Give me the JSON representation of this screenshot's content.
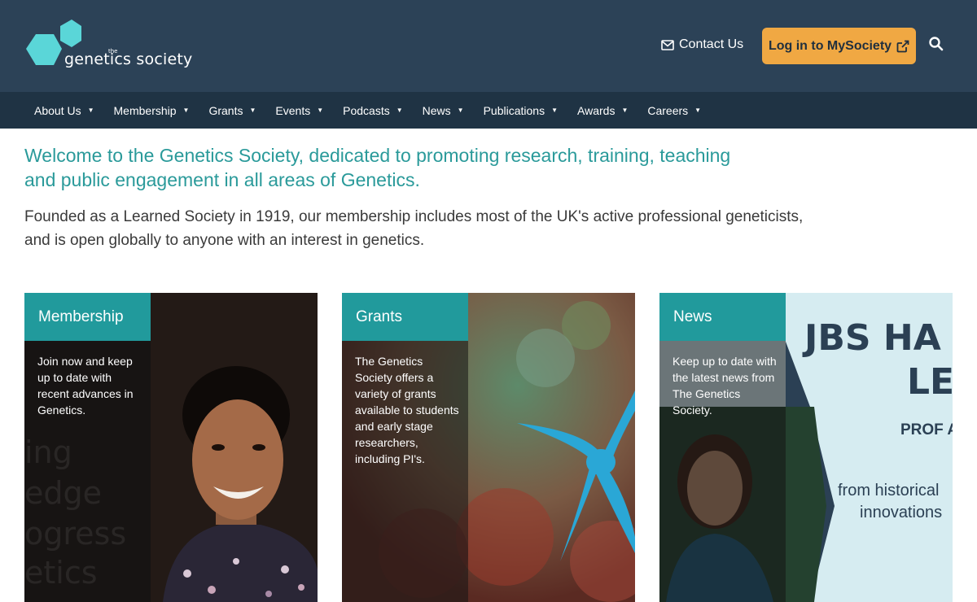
{
  "header": {
    "logo_small": "the",
    "logo_text": "genetics society",
    "contact_label": "Contact Us",
    "login_label": "Log in to MySociety"
  },
  "nav": {
    "items": [
      {
        "label": "About Us"
      },
      {
        "label": "Membership"
      },
      {
        "label": "Grants"
      },
      {
        "label": "Events"
      },
      {
        "label": "Podcasts"
      },
      {
        "label": "News"
      },
      {
        "label": "Publications"
      },
      {
        "label": "Awards"
      },
      {
        "label": "Careers"
      }
    ]
  },
  "intro": {
    "welcome": "Welcome to the Genetics Society, dedicated to promoting research, training, teaching and public engagement in all areas of Genetics.",
    "founded": "Founded as a Learned Society in 1919, our membership includes most of the UK's active professional geneticists, and is open globally to anyone with an interest in genetics."
  },
  "cards": [
    {
      "label": "Membership",
      "description": "Join now and keep up to date with recent advances in Genetics."
    },
    {
      "label": "Grants",
      "description": "The Genetics Society offers a variety of grants available to students and early stage researchers, including PI's."
    },
    {
      "label": "News",
      "description": "Keep up to date with the latest news from The Genetics Society."
    }
  ],
  "membership_art": {
    "ghost_lines": [
      "ing",
      "edge",
      "ogress",
      "etics"
    ]
  },
  "news_art": {
    "title_line1": "JBS HA",
    "title_line2": "LE",
    "prof": "PROF A",
    "line1": "from historical",
    "line2": "innovations"
  },
  "colors": {
    "header_bg": "#2c4257",
    "nav_bg": "#1f3344",
    "accent_teal": "#219a9c",
    "login_orange": "#f0a843",
    "logo_teal": "#5ad6d8"
  }
}
